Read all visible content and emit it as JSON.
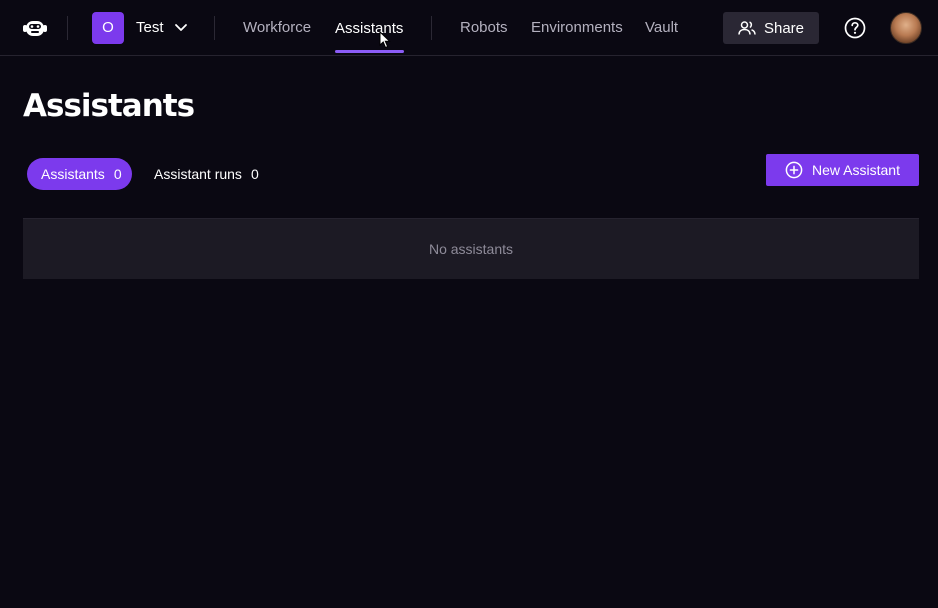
{
  "header": {
    "logo_icon": "robot-monkey-logo-icon",
    "org": {
      "initial": "O",
      "name": "Test",
      "badge_color": "#7c3aed"
    },
    "nav": [
      {
        "label": "Workforce",
        "active": false
      },
      {
        "label": "Assistants",
        "active": true
      },
      {
        "label": "Robots",
        "active": false
      },
      {
        "label": "Environments",
        "active": false
      },
      {
        "label": "Vault",
        "active": false
      }
    ],
    "share_label": "Share",
    "help_icon": "question-circle-icon",
    "avatar_icon": "user-avatar"
  },
  "main": {
    "title": "Assistants",
    "tabs": [
      {
        "label": "Assistants",
        "count": "0",
        "active": true
      },
      {
        "label": "Assistant runs",
        "count": "0",
        "active": false
      }
    ],
    "new_button_label": "New Assistant",
    "empty_text": "No assistants"
  },
  "colors": {
    "background": "#0a0812",
    "accent": "#7c3aed",
    "panel": "#1c1a24",
    "muted_text": "#8e8b99"
  }
}
